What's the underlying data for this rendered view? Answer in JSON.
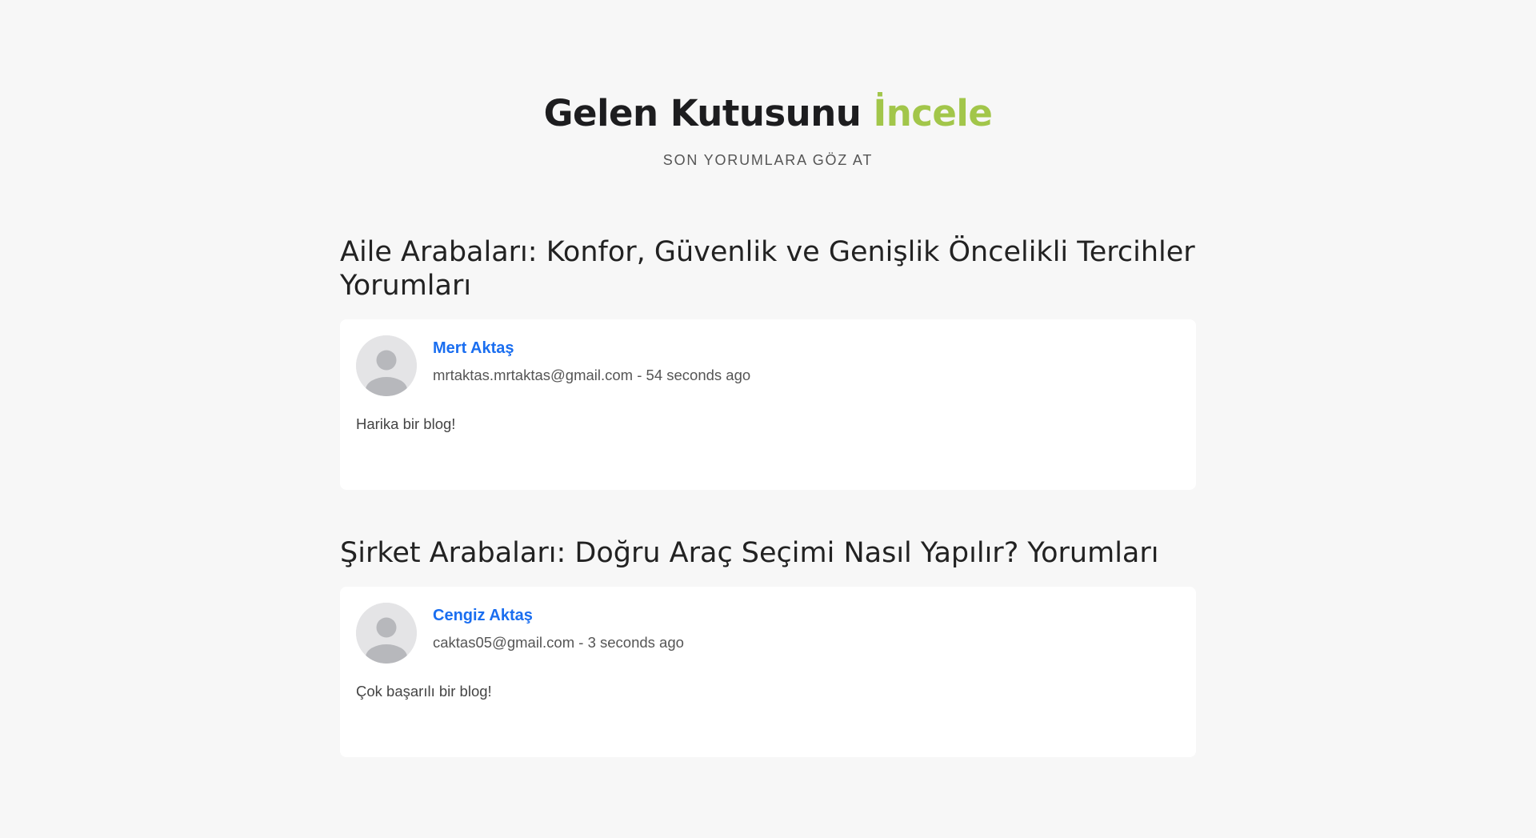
{
  "hero": {
    "title_main": "Gelen Kutusunu",
    "title_accent": "İncele",
    "subtitle": "SON YORUMLARA GÖZ AT"
  },
  "posts": [
    {
      "title": "Aile Arabaları: Konfor, Güvenlik ve Genişlik Öncelikli Tercihler Yorumları",
      "comments": [
        {
          "author": "Mert Aktaş",
          "email": "mrtaktas.mrtaktas@gmail.com",
          "separator": " - ",
          "time": "54 seconds ago",
          "text": "Harika bir blog!",
          "avatar_icon": "user-avatar-icon"
        }
      ]
    },
    {
      "title": "Şirket Arabaları: Doğru Araç Seçimi Nasıl Yapılır? Yorumları",
      "comments": [
        {
          "author": "Cengiz Aktaş",
          "email": "caktas05@gmail.com",
          "separator": " - ",
          "time": "3 seconds ago",
          "text": "Çok başarılı bir blog!",
          "avatar_icon": "user-avatar-icon"
        }
      ]
    }
  ],
  "colors": {
    "accent": "#a2c64a",
    "link": "#1a6ef0",
    "background": "#f7f7f7"
  }
}
